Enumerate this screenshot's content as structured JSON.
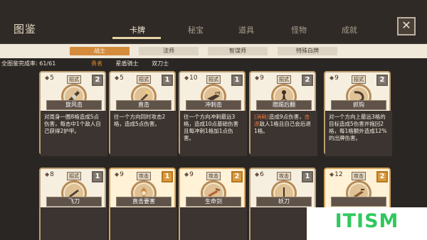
{
  "header": {
    "title": "图鉴",
    "tabs": [
      {
        "label": "卡牌",
        "active": true
      },
      {
        "label": "秘宝",
        "active": false
      },
      {
        "label": "道具",
        "active": false
      },
      {
        "label": "怪物",
        "active": false
      },
      {
        "label": "成就",
        "active": false
      }
    ],
    "close_label": "✕"
  },
  "subnav": {
    "categories": [
      {
        "label": "战士",
        "active": true
      },
      {
        "label": "法师",
        "active": false
      },
      {
        "label": "智谋师",
        "active": false
      },
      {
        "label": "特殊白牌",
        "active": false
      }
    ],
    "progress": "全图鉴完成率: 61/61",
    "classes": [
      "勇者",
      "星盾骑士",
      "双刀士"
    ]
  },
  "colors": {
    "accent": "#d48c3c",
    "card_bg": "#f6efe0",
    "desc_bg": "#3b3430",
    "rank_gray": "#7f776e",
    "rank_orange": "#d79a3f"
  },
  "cards": [
    {
      "cost": "5",
      "type": "招式",
      "rank": "2",
      "name": "旋风击",
      "desc": [
        "对周身一圈8格造成5点伤害，每击中1个敌人自己获得2护甲。"
      ],
      "icon": "whirlwind-icon"
    },
    {
      "cost": "5",
      "type": "招式",
      "rank": "1",
      "name": "直击",
      "desc": [
        "往一个方向同时攻击2格，造成5点伤害。"
      ],
      "icon": "straight-strike-icon"
    },
    {
      "cost": "10",
      "type": "招式",
      "rank": "1",
      "name": "冲刺击",
      "desc": [
        "往一个方向冲刺最远3格，造成10点基础伤害且每冲刺1格加1点伤害。"
      ],
      "icon": "dash-icon"
    },
    {
      "cost": "9",
      "type": "招式",
      "rank": "2",
      "name": "蹬踢后翻",
      "desc": [
        "(消耗)",
        "造成9点伤害，",
        "击退",
        "敌人1格且自己会后退1格。"
      ],
      "icon": "kick-icon"
    },
    {
      "cost": "9",
      "type": "招式",
      "rank": "2",
      "name": "抓钩",
      "desc": [
        "对一个方向上最远3格的目标造成5伤害并拖回2格，每1格额外造成12%的出牌伤害。"
      ],
      "icon": "hook-icon"
    },
    {
      "cost": "8",
      "type": "招式",
      "rank": "1",
      "name": "飞刀",
      "desc": [
        ""
      ],
      "icon": "throwing-knife-icon"
    },
    {
      "cost": "9",
      "type": "攻击",
      "rank": "1",
      "name": "直击要害",
      "desc": [
        ""
      ],
      "icon": "vital-strike-icon"
    },
    {
      "cost": "9",
      "type": "攻击",
      "rank": "2",
      "name": "生命剑",
      "desc": [
        ""
      ],
      "icon": "life-sword-icon"
    },
    {
      "cost": "6",
      "type": "攻击",
      "rank": "1",
      "name": "妖刀",
      "desc": [
        ""
      ],
      "icon": "demon-blade-icon"
    },
    {
      "cost": "12",
      "type": "攻击",
      "rank": "2",
      "name": "",
      "desc": [
        ""
      ],
      "icon": "knife-icon"
    }
  ],
  "watermark": {
    "main": "IT",
    "rest": "ISM"
  }
}
